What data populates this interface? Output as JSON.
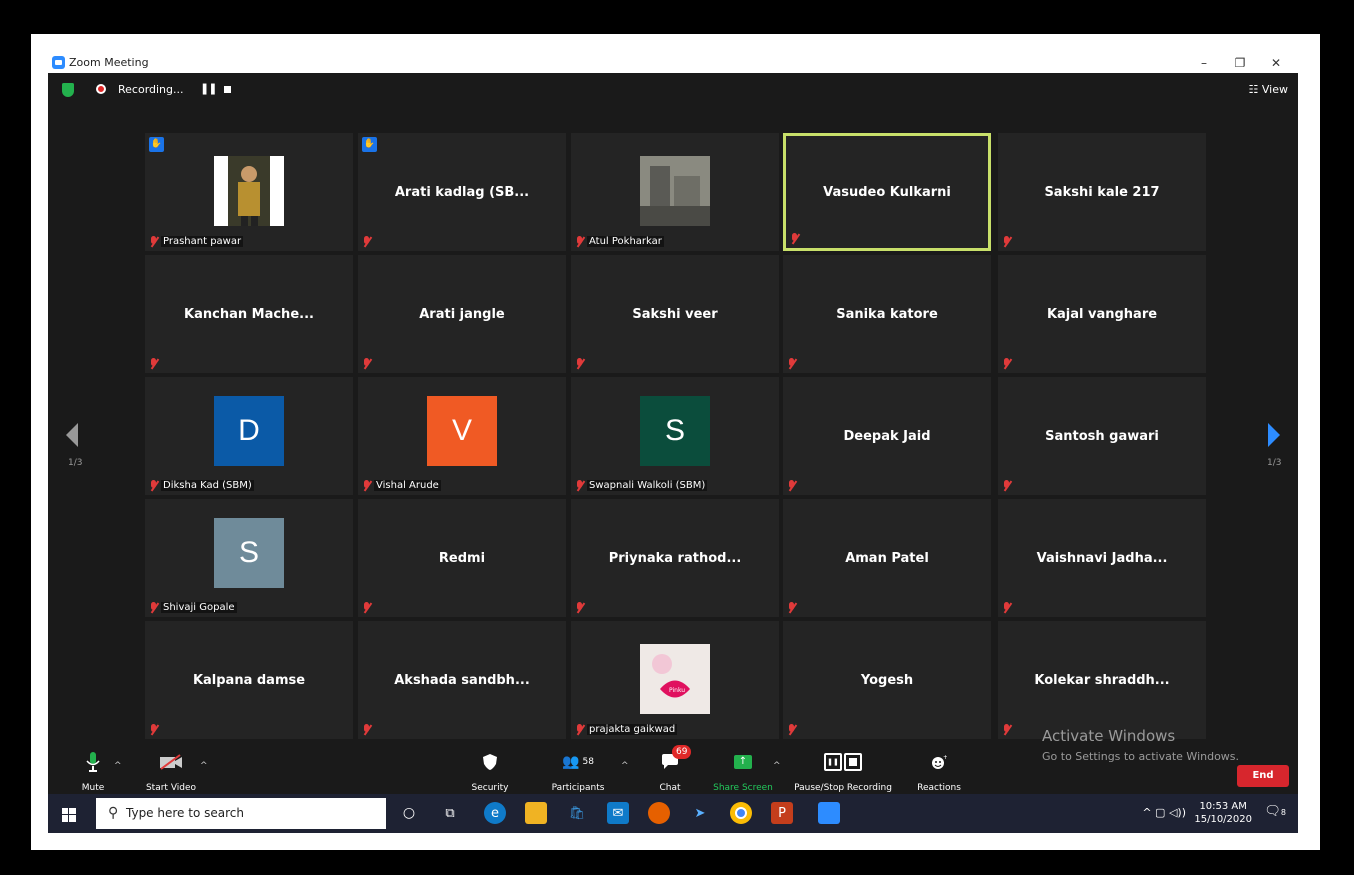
{
  "window": {
    "title": "Zoom Meeting",
    "minimize": "–",
    "restore": "❐",
    "close": "✕"
  },
  "topbar": {
    "recording": "Recording...",
    "view": "View"
  },
  "pager": {
    "left": "1/3",
    "right": "1/3"
  },
  "tiles": [
    {
      "name": "Prashant pawar",
      "label": "Prashant pawar",
      "type": "photo",
      "hand": true
    },
    {
      "name": "Arati kadlag (SB...",
      "label": "",
      "type": "name",
      "hand": true
    },
    {
      "name": "Atul Pokharkar",
      "label": "Atul Pokharkar",
      "type": "photo2"
    },
    {
      "name": "Vasudeo Kulkarni",
      "label": "",
      "type": "name",
      "active": true
    },
    {
      "name": "Sakshi  kale  217",
      "label": "",
      "type": "name"
    },
    {
      "name": "Kanchan  Mache...",
      "label": "",
      "type": "name"
    },
    {
      "name": "Arati jangle",
      "label": "",
      "type": "name"
    },
    {
      "name": "Sakshi veer",
      "label": "",
      "type": "name"
    },
    {
      "name": "Sanika katore",
      "label": "",
      "type": "name"
    },
    {
      "name": "Kajal vanghare",
      "label": "",
      "type": "name"
    },
    {
      "name": "D",
      "label": "Diksha Kad (SBM)",
      "type": "avatar",
      "color": "#0b5aa7"
    },
    {
      "name": "V",
      "label": "Vishal Arude",
      "type": "avatar",
      "color": "#f05a24"
    },
    {
      "name": "S",
      "label": "Swapnali Walkoli (SBM)",
      "type": "avatar",
      "color": "#0b4d3c"
    },
    {
      "name": "Deepak Jaid",
      "label": "",
      "type": "name"
    },
    {
      "name": "Santosh gawari",
      "label": "",
      "type": "name"
    },
    {
      "name": "S",
      "label": "Shivaji Gopale",
      "type": "avatar",
      "color": "#6f8b9a"
    },
    {
      "name": "Redmi",
      "label": "",
      "type": "name"
    },
    {
      "name": "Priynaka  rathod...",
      "label": "",
      "type": "name"
    },
    {
      "name": "Aman Patel",
      "label": "",
      "type": "name"
    },
    {
      "name": "Vaishnavi  Jadha...",
      "label": "",
      "type": "name"
    },
    {
      "name": "Kalpana damse",
      "label": "",
      "type": "name"
    },
    {
      "name": "Akshada  sandbh...",
      "label": "",
      "type": "name"
    },
    {
      "name": "prajakta gaikwad",
      "label": "prajakta gaikwad",
      "type": "photo3"
    },
    {
      "name": "Yogesh",
      "label": "",
      "type": "name"
    },
    {
      "name": "Kolekar  shraddh...",
      "label": "",
      "type": "name"
    }
  ],
  "toolbar": {
    "mute": "Mute",
    "start_video": "Start Video",
    "security": "Security",
    "participants": "Participants",
    "participants_count": "58",
    "chat": "Chat",
    "chat_badge": "69",
    "share_screen": "Share Screen",
    "pause_stop": "Pause/Stop Recording",
    "reactions": "Reactions",
    "end": "End"
  },
  "watermark": {
    "line1": "Activate Windows",
    "line2": "Go to Settings to activate Windows."
  },
  "taskbar": {
    "search_placeholder": "Type here to search",
    "time": "10:53 AM",
    "date": "15/10/2020",
    "notif_count": "8"
  }
}
